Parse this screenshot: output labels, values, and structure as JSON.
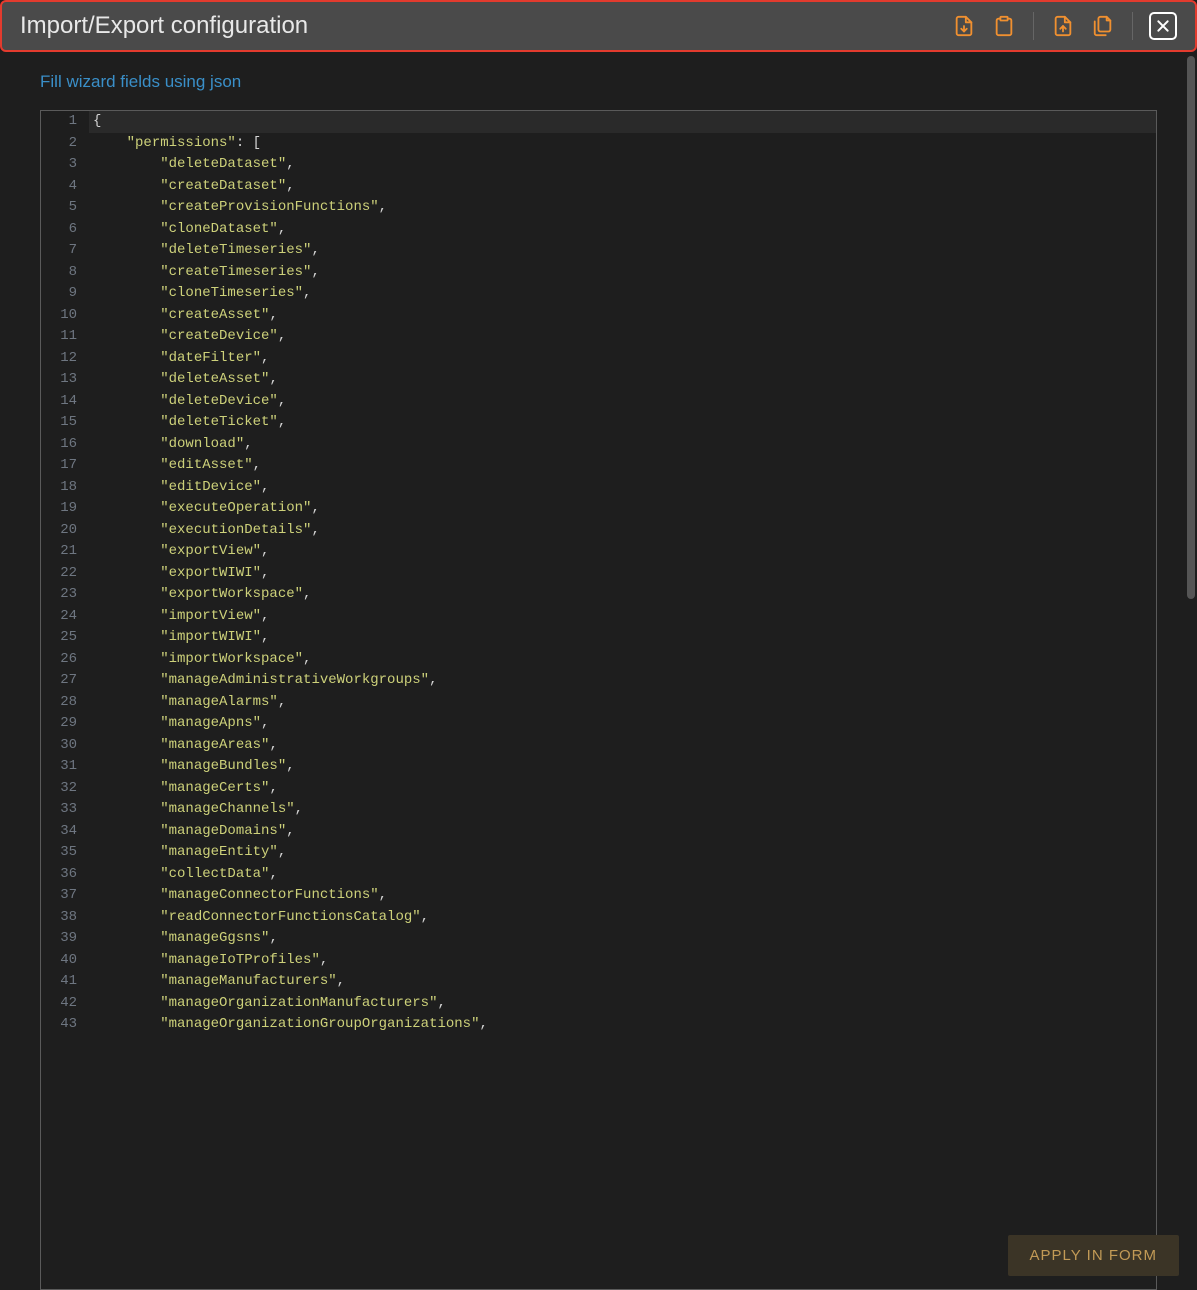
{
  "header": {
    "title": "Import/Export configuration",
    "icons": [
      "file-export-icon",
      "clipboard-icon",
      "file-import-icon",
      "files-icon",
      "close-icon"
    ]
  },
  "link_text": "Fill wizard fields using json",
  "apply_label": "APPLY IN FORM",
  "code_lines": [
    {
      "indent": 0,
      "pre": "{",
      "str": null,
      "post": null
    },
    {
      "indent": 1,
      "pre": "",
      "str": "permissions",
      "post": ": ["
    },
    {
      "indent": 2,
      "pre": "",
      "str": "deleteDataset",
      "post": ","
    },
    {
      "indent": 2,
      "pre": "",
      "str": "createDataset",
      "post": ","
    },
    {
      "indent": 2,
      "pre": "",
      "str": "createProvisionFunctions",
      "post": ","
    },
    {
      "indent": 2,
      "pre": "",
      "str": "cloneDataset",
      "post": ","
    },
    {
      "indent": 2,
      "pre": "",
      "str": "deleteTimeseries",
      "post": ","
    },
    {
      "indent": 2,
      "pre": "",
      "str": "createTimeseries",
      "post": ","
    },
    {
      "indent": 2,
      "pre": "",
      "str": "cloneTimeseries",
      "post": ","
    },
    {
      "indent": 2,
      "pre": "",
      "str": "createAsset",
      "post": ","
    },
    {
      "indent": 2,
      "pre": "",
      "str": "createDevice",
      "post": ","
    },
    {
      "indent": 2,
      "pre": "",
      "str": "dateFilter",
      "post": ","
    },
    {
      "indent": 2,
      "pre": "",
      "str": "deleteAsset",
      "post": ","
    },
    {
      "indent": 2,
      "pre": "",
      "str": "deleteDevice",
      "post": ","
    },
    {
      "indent": 2,
      "pre": "",
      "str": "deleteTicket",
      "post": ","
    },
    {
      "indent": 2,
      "pre": "",
      "str": "download",
      "post": ","
    },
    {
      "indent": 2,
      "pre": "",
      "str": "editAsset",
      "post": ","
    },
    {
      "indent": 2,
      "pre": "",
      "str": "editDevice",
      "post": ","
    },
    {
      "indent": 2,
      "pre": "",
      "str": "executeOperation",
      "post": ","
    },
    {
      "indent": 2,
      "pre": "",
      "str": "executionDetails",
      "post": ","
    },
    {
      "indent": 2,
      "pre": "",
      "str": "exportView",
      "post": ","
    },
    {
      "indent": 2,
      "pre": "",
      "str": "exportWIWI",
      "post": ","
    },
    {
      "indent": 2,
      "pre": "",
      "str": "exportWorkspace",
      "post": ","
    },
    {
      "indent": 2,
      "pre": "",
      "str": "importView",
      "post": ","
    },
    {
      "indent": 2,
      "pre": "",
      "str": "importWIWI",
      "post": ","
    },
    {
      "indent": 2,
      "pre": "",
      "str": "importWorkspace",
      "post": ","
    },
    {
      "indent": 2,
      "pre": "",
      "str": "manageAdministrativeWorkgroups",
      "post": ","
    },
    {
      "indent": 2,
      "pre": "",
      "str": "manageAlarms",
      "post": ","
    },
    {
      "indent": 2,
      "pre": "",
      "str": "manageApns",
      "post": ","
    },
    {
      "indent": 2,
      "pre": "",
      "str": "manageAreas",
      "post": ","
    },
    {
      "indent": 2,
      "pre": "",
      "str": "manageBundles",
      "post": ","
    },
    {
      "indent": 2,
      "pre": "",
      "str": "manageCerts",
      "post": ","
    },
    {
      "indent": 2,
      "pre": "",
      "str": "manageChannels",
      "post": ","
    },
    {
      "indent": 2,
      "pre": "",
      "str": "manageDomains",
      "post": ","
    },
    {
      "indent": 2,
      "pre": "",
      "str": "manageEntity",
      "post": ","
    },
    {
      "indent": 2,
      "pre": "",
      "str": "collectData",
      "post": ","
    },
    {
      "indent": 2,
      "pre": "",
      "str": "manageConnectorFunctions",
      "post": ","
    },
    {
      "indent": 2,
      "pre": "",
      "str": "readConnectorFunctionsCatalog",
      "post": ","
    },
    {
      "indent": 2,
      "pre": "",
      "str": "manageGgsns",
      "post": ","
    },
    {
      "indent": 2,
      "pre": "",
      "str": "manageIoTProfiles",
      "post": ","
    },
    {
      "indent": 2,
      "pre": "",
      "str": "manageManufacturers",
      "post": ","
    },
    {
      "indent": 2,
      "pre": "",
      "str": "manageOrganizationManufacturers",
      "post": ","
    },
    {
      "indent": 2,
      "pre": "",
      "str": "manageOrganizationGroupOrganizations",
      "post": ","
    }
  ]
}
